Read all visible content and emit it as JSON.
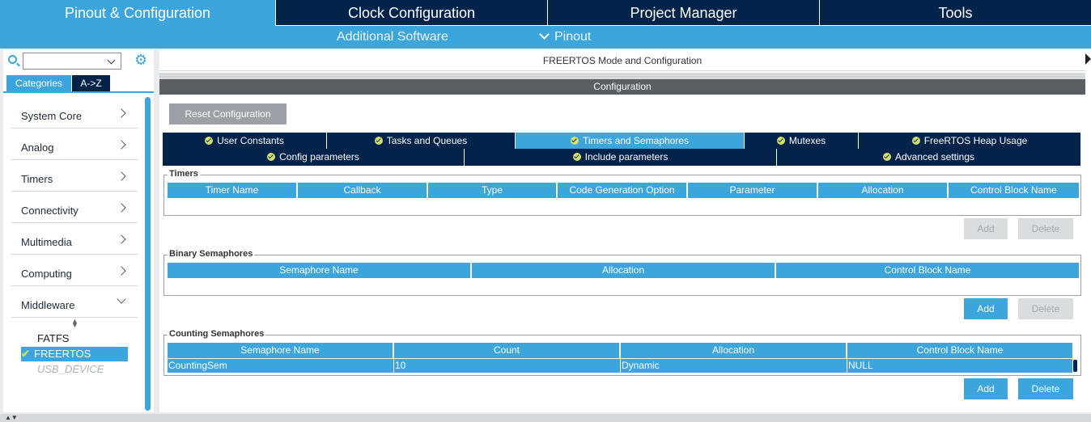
{
  "top_tabs": [
    "Pinout & Configuration",
    "Clock Configuration",
    "Project Manager",
    "Tools"
  ],
  "sub_bar": {
    "additional_software": "Additional Software",
    "pinout": "Pinout"
  },
  "left": {
    "search_value": "",
    "tabs": {
      "categories": "Categories",
      "az": "A->Z"
    },
    "categories": [
      "System Core",
      "Analog",
      "Timers",
      "Connectivity",
      "Multimedia",
      "Computing",
      "Middleware"
    ],
    "middleware_items": [
      {
        "label": "FATFS",
        "state": "normal"
      },
      {
        "label": "FREERTOS",
        "state": "selected"
      },
      {
        "label": "USB_DEVICE",
        "state": "disabled"
      }
    ]
  },
  "main": {
    "mode_title": "FREERTOS Mode and Configuration",
    "config_title": "Configuration",
    "reset_button": "Reset Configuration",
    "tabs_row1": [
      "User Constants",
      "Tasks and Queues",
      "Timers and Semaphores",
      "Mutexes",
      "FreeRTOS Heap Usage"
    ],
    "tabs_row2": [
      "Config parameters",
      "Include parameters",
      "Advanced settings"
    ],
    "active_tab": "Timers and Semaphores",
    "timers": {
      "title": "Timers",
      "headers": [
        "Timer Name",
        "Callback",
        "Type",
        "Code Generation Option",
        "Parameter",
        "Allocation",
        "Control Block Name"
      ],
      "add": "Add",
      "delete": "Delete"
    },
    "binary": {
      "title": "Binary Semaphores",
      "headers": [
        "Semaphore Name",
        "Allocation",
        "Control Block Name"
      ],
      "add": "Add",
      "delete": "Delete"
    },
    "counting": {
      "title": "Counting Semaphores",
      "headers": [
        "Semaphore Name",
        "Count",
        "Allocation",
        "Control Block Name"
      ],
      "rows": [
        [
          "CountingSem",
          "10",
          "Dynamic",
          "NULL"
        ]
      ],
      "add": "Add",
      "delete": "Delete"
    }
  },
  "colors": {
    "navy": "#03234b",
    "blue": "#3ca5dc",
    "gray": "#5a5f63"
  }
}
